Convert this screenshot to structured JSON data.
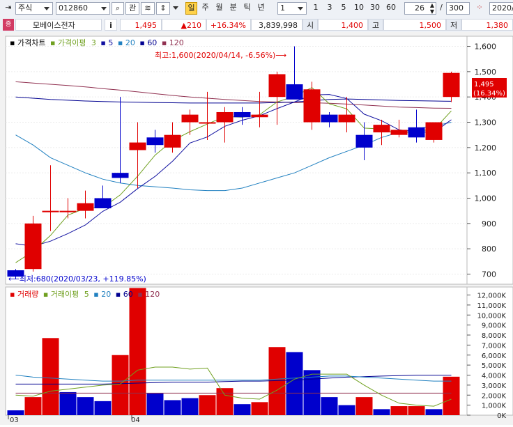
{
  "toolbar": {
    "market_select": "주식",
    "code_value": "012860",
    "tab_buttons": [
      "관"
    ],
    "period_active": "일",
    "periods": [
      "주",
      "월",
      "분",
      "틱",
      "년"
    ],
    "interval_select": "1",
    "interval_buttons": [
      "1",
      "3",
      "5",
      "10",
      "30",
      "60"
    ],
    "count_value": "26",
    "count_separator": "/",
    "total_value": "300",
    "date_value": "2020/"
  },
  "quote": {
    "name": "모베이스전자",
    "info_icon_label": "i",
    "price": "1,495",
    "change": "▲210",
    "change_pct": "+16.34%",
    "volume": "3,839,998",
    "open_label": "시",
    "open": "1,400",
    "high_label": "고",
    "high": "1,500",
    "low_label": "저",
    "low": "1,380"
  },
  "price_legend": {
    "title": "가격차트",
    "ma_title": "가격이평",
    "ma_periods": [
      "3",
      "5",
      "20",
      "60",
      "120"
    ]
  },
  "volume_legend": {
    "title": "거래량",
    "ma_title": "거래이평",
    "ma_periods": [
      "5",
      "20",
      "60",
      "120"
    ]
  },
  "colors": {
    "up": "#e00000",
    "down": "#0000cc",
    "ma3": "#70a020",
    "ma5": "#1010a0",
    "ma20": "#2080c0",
    "ma60": "#000090",
    "ma120": "#903050"
  },
  "chart_data": [
    {
      "type": "candlestick",
      "dates": [
        "2020/03/23",
        "2020/03/24",
        "2020/03/25",
        "2020/03/26",
        "2020/03/27",
        "2020/03/30",
        "2020/03/31",
        "2020/04/01",
        "2020/04/02",
        "2020/04/03",
        "2020/04/06",
        "2020/04/07",
        "2020/04/08",
        "2020/04/09",
        "2020/04/10",
        "2020/04/13",
        "2020/04/14",
        "2020/04/15",
        "2020/04/16",
        "2020/04/17",
        "2020/04/20",
        "2020/04/21",
        "2020/04/22",
        "2020/04/23",
        "2020/04/24",
        "2020/04/27"
      ],
      "open": [
        715,
        720,
        950,
        950,
        950,
        1000,
        1100,
        1190,
        1240,
        1200,
        1300,
        1300,
        1300,
        1340,
        1320,
        1400,
        1450,
        1300,
        1330,
        1300,
        1250,
        1260,
        1250,
        1280,
        1230,
        1400
      ],
      "high": [
        720,
        930,
        1130,
        1000,
        1030,
        1050,
        1400,
        1300,
        1270,
        1300,
        1350,
        1420,
        1360,
        1360,
        1420,
        1500,
        1600,
        1460,
        1340,
        1400,
        1300,
        1310,
        1310,
        1350,
        1300,
        1500
      ],
      "low": [
        680,
        710,
        870,
        920,
        920,
        960,
        1060,
        1040,
        1180,
        1180,
        1250,
        1230,
        1220,
        1290,
        1280,
        1290,
        1420,
        1270,
        1280,
        1260,
        1150,
        1210,
        1240,
        1220,
        1220,
        1380
      ],
      "close": [
        690,
        900,
        950,
        950,
        980,
        960,
        1080,
        1220,
        1210,
        1250,
        1330,
        1300,
        1340,
        1320,
        1330,
        1490,
        1390,
        1430,
        1300,
        1330,
        1200,
        1290,
        1270,
        1240,
        1300,
        1495
      ],
      "ma": {
        "3": [
          745,
          790,
          853,
          933,
          960,
          963,
          1013,
          1087,
          1170,
          1227,
          1263,
          1293,
          1323,
          1320,
          1330,
          1380,
          1403,
          1437,
          1373,
          1353,
          1277,
          1273,
          1253,
          1267,
          1270,
          1345
        ],
        "5": [
          820,
          810,
          830,
          860,
          894,
          948,
          984,
          1038,
          1086,
          1146,
          1218,
          1242,
          1284,
          1308,
          1326,
          1354,
          1380,
          1408,
          1410,
          1394,
          1332,
          1306,
          1270,
          1262,
          1260,
          1310
        ],
        "20": [
          1250,
          1210,
          1160,
          1130,
          1100,
          1075,
          1060,
          1050,
          1045,
          1040,
          1033,
          1030,
          1030,
          1040,
          1060,
          1080,
          1100,
          1130,
          1160,
          1185,
          1210,
          1240,
          1260,
          1275,
          1285,
          1300
        ],
        "60": [
          1400,
          1395,
          1390,
          1387,
          1384,
          1382,
          1380,
          1379,
          1378,
          1377,
          1376,
          1376,
          1376,
          1376,
          1376,
          1378,
          1380,
          1385,
          1390,
          1392,
          1390,
          1388,
          1386,
          1385,
          1384,
          1383
        ],
        "120": [
          1460,
          1455,
          1450,
          1445,
          1440,
          1433,
          1427,
          1420,
          1413,
          1406,
          1400,
          1395,
          1390,
          1386,
          1382,
          1380,
          1378,
          1377,
          1375,
          1372,
          1368,
          1364,
          1360,
          1358,
          1356,
          1355
        ]
      },
      "yaxis_ticks": [
        700,
        800,
        900,
        1000,
        1100,
        1200,
        1300,
        1400,
        1500,
        1600
      ],
      "ylim": [
        660,
        1640
      ],
      "last_price_label": "1,495",
      "last_pct_label": "(16.34%)",
      "annotation_high": "최고:1,600(2020/04/14, -6.56%)⟶",
      "annotation_low": "⟵최저:680(2020/03/23, +119.85%)",
      "x_labels": [
        "03",
        "04"
      ]
    },
    {
      "type": "bar",
      "values": [
        480000,
        1800000,
        7700000,
        2300000,
        1800000,
        1400000,
        6000000,
        12700000,
        2200000,
        1500000,
        1700000,
        2000000,
        2700000,
        1100000,
        1300000,
        6800000,
        6300000,
        4500000,
        1800000,
        1000000,
        1800000,
        600000,
        900000,
        900000,
        600000,
        3840000
      ],
      "colors_by_day": [
        "down",
        "up",
        "up",
        "down",
        "down",
        "down",
        "up",
        "up",
        "down",
        "down",
        "down",
        "up",
        "up",
        "down",
        "up",
        "up",
        "down",
        "down",
        "down",
        "down",
        "up",
        "down",
        "up",
        "up",
        "down",
        "up"
      ],
      "ma": {
        "5": [
          2000000,
          1900000,
          2400000,
          2600000,
          2800000,
          3000000,
          3100000,
          4500000,
          4800000,
          4800000,
          4600000,
          4700000,
          2000000,
          1700000,
          1600000,
          2500000,
          3600000,
          4100000,
          4100000,
          4100000,
          3000000,
          2000000,
          1200000,
          1000000,
          900000,
          1600000
        ],
        "20": [
          4000000,
          3800000,
          3700000,
          3600000,
          3500000,
          3400000,
          3400000,
          3500000,
          3500000,
          3500000,
          3500000,
          3500000,
          3500000,
          3500000,
          3500000,
          3600000,
          3700000,
          3800000,
          3900000,
          3900000,
          3800000,
          3700000,
          3600000,
          3500000,
          3400000,
          3400000
        ],
        "60": [
          3100000,
          3100000,
          3100000,
          3100000,
          3100000,
          3100000,
          3150000,
          3200000,
          3250000,
          3300000,
          3300000,
          3300000,
          3350000,
          3400000,
          3400000,
          3450000,
          3500000,
          3600000,
          3700000,
          3800000,
          3850000,
          3900000,
          3950000,
          4000000,
          4000000,
          4000000
        ],
        "120": [
          2200000,
          2200000,
          2200000,
          2200000,
          2200000,
          2200000,
          2200000,
          2200000,
          2200000,
          2200000,
          2200000,
          2200000,
          2200000,
          2200000,
          2200000,
          2200000,
          2200000,
          2200000,
          2200000,
          2200000,
          2200000,
          2200000,
          2200000,
          2200000,
          2200000,
          2200000
        ]
      },
      "yaxis_ticks": [
        "0K",
        "1,000K",
        "2,000K",
        "3,000K",
        "4,000K",
        "5,000K",
        "6,000K",
        "7,000K",
        "8,000K",
        "9,000K",
        "10,000K",
        "11,000K",
        "12,000K"
      ],
      "ylim": [
        0,
        12800000
      ]
    }
  ]
}
